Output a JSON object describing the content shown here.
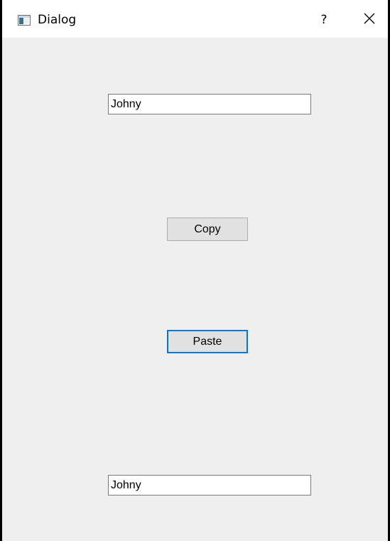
{
  "window": {
    "title": "Dialog",
    "help_label": "?",
    "close_icon": "close-icon",
    "app_icon": "window-app-icon"
  },
  "form": {
    "top_input_value": "Johny",
    "copy_label": "Copy",
    "paste_label": "Paste",
    "bottom_input_value": "Johny",
    "focused_button": "Paste"
  },
  "colors": {
    "client_background": "#efefef",
    "button_face": "#e1e1e1",
    "focus_border": "#0078d7"
  }
}
